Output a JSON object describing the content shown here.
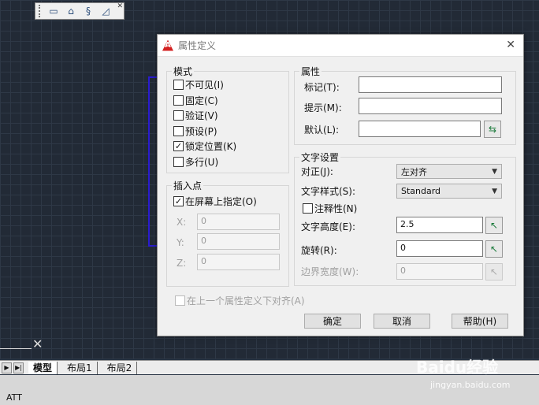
{
  "toolbar": {
    "buttons": [
      "ruler-icon",
      "block-insert-icon",
      "attribute-icon",
      "edit-attribute-icon"
    ]
  },
  "dialog": {
    "title": "属性定义",
    "mode": {
      "legend": "模式",
      "options": [
        {
          "label": "不可见(I)",
          "checked": false
        },
        {
          "label": "固定(C)",
          "checked": false
        },
        {
          "label": "验证(V)",
          "checked": false
        },
        {
          "label": "预设(P)",
          "checked": false
        },
        {
          "label": "锁定位置(K)",
          "checked": true
        },
        {
          "label": "多行(U)",
          "checked": false
        }
      ]
    },
    "insertion": {
      "legend": "插入点",
      "on_screen_label": "在屏幕上指定(O)",
      "on_screen_checked": true,
      "x_label": "X:",
      "x_value": "0",
      "y_label": "Y:",
      "y_value": "0",
      "z_label": "Z:",
      "z_value": "0"
    },
    "attribute": {
      "legend": "属性",
      "tag_label": "标记(T):",
      "tag_value": "",
      "prompt_label": "提示(M):",
      "prompt_value": "",
      "default_label": "默认(L):",
      "default_value": ""
    },
    "text": {
      "legend": "文字设置",
      "justify_label": "对正(J):",
      "justify_value": "左对齐",
      "style_label": "文字样式(S):",
      "style_value": "Standard",
      "annotative_label": "注释性(N)",
      "annotative_checked": false,
      "height_label": "文字高度(E):",
      "height_value": "2.5",
      "rotation_label": "旋转(R):",
      "rotation_value": "0",
      "boundary_label": "边界宽度(W):",
      "boundary_value": "0"
    },
    "align_below_label": "在上一个属性定义下对齐(A)",
    "ok_label": "确定",
    "cancel_label": "取消",
    "help_label": "帮助(H)"
  },
  "tabs": [
    "模型",
    "布局1",
    "布局2"
  ],
  "command_text": "ATT",
  "watermark": {
    "main": "Baidu经验",
    "sub": "jingyan.baidu.com"
  }
}
